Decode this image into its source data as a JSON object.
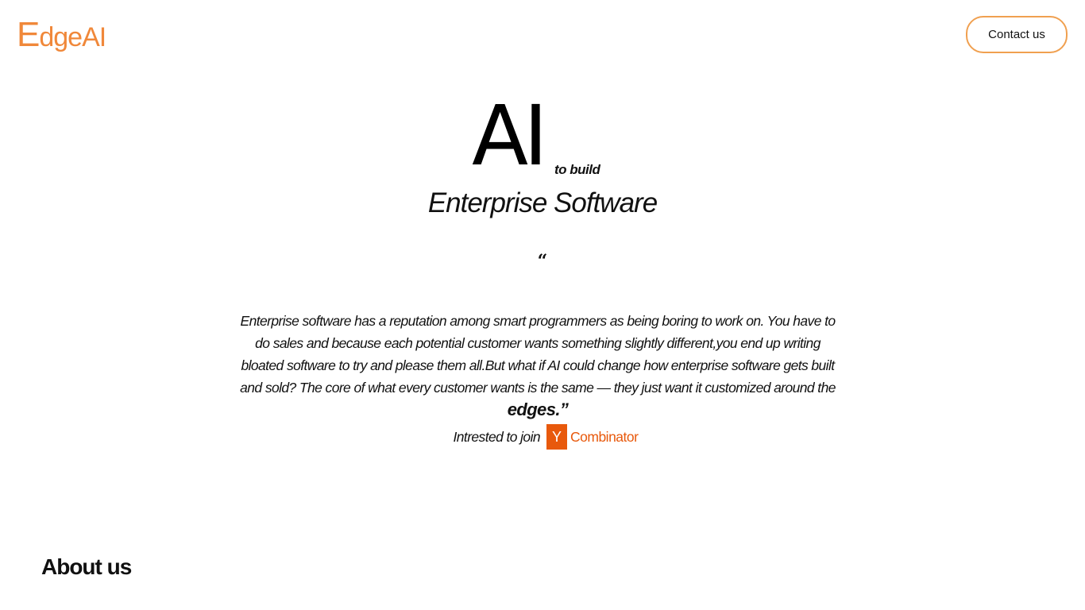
{
  "colors": {
    "brand_orange": "#f0883a",
    "button_border": "#f0a050",
    "yc_orange": "#e8590c",
    "text": "#111111",
    "background": "#ffffff"
  },
  "header": {
    "logo_initial": "E",
    "logo_rest": "dgeAI",
    "contact_label": "Contact us"
  },
  "hero": {
    "title": "AI",
    "title_suffix": "to build",
    "subtitle": "Enterprise Software"
  },
  "quote": {
    "mark": "“",
    "text": "Enterprise software has a reputation among smart programmers as being boring to work on. You have to do sales and because each potential customer wants something slightly different,you end up writing bloated software to try and please them all.But what if AI could change how enterprise software gets built and sold? The core of what every customer wants is the same — they just want it customized around the",
    "emphasis": "edges.”"
  },
  "yc": {
    "label": "Intrested to join",
    "icon_letter": "Y",
    "icon_name": "y-combinator-logo-icon",
    "word": "Combinator"
  },
  "about": {
    "heading": "About us"
  }
}
